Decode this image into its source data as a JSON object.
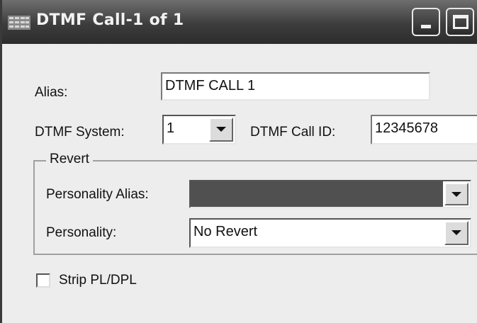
{
  "window": {
    "title": "DTMF Call-1 of 1",
    "title_icon": "grid-app-icon",
    "controls": {
      "minimize_icon": "minimize-icon",
      "maximize_icon": "maximize-icon"
    }
  },
  "form": {
    "alias_label": "Alias:",
    "alias_value": "DTMF CALL 1",
    "system_label": "DTMF System:",
    "system_value": "1",
    "call_id_label": "DTMF Call ID:",
    "call_id_value": "12345678",
    "revert": {
      "group_label": "Revert",
      "personality_alias_label": "Personality Alias:",
      "personality_alias_value": "",
      "personality_label": "Personality:",
      "personality_value": "No Revert"
    },
    "strip_label": "Strip PL/DPL",
    "strip_checked": false
  }
}
